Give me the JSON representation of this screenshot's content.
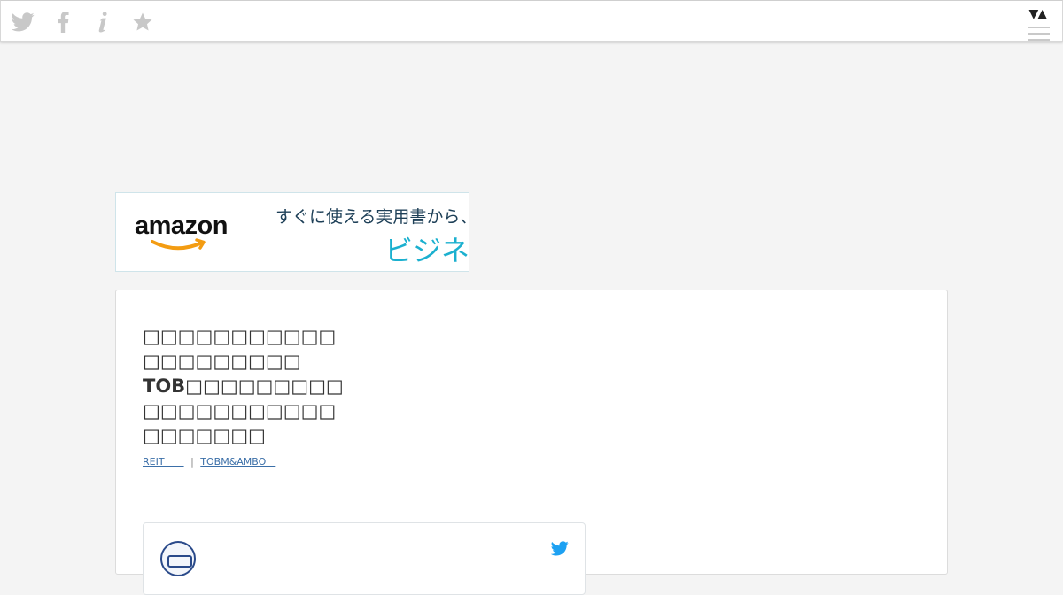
{
  "topbar": {
    "icons": [
      "twitter-icon",
      "facebook-icon",
      "info-icon",
      "star-icon"
    ],
    "sort_label": "▼▲",
    "menu_icon": "hamburger-icon"
  },
  "ad": {
    "brand": "amazon",
    "line1": "すぐに使える実用書から、書",
    "line2": "ビジネス",
    "brand_color": "#111111",
    "accent_color": "#1bb0cf"
  },
  "article": {
    "title_lines": [
      "□□□□□□□□□□□",
      "□□□□□□□□□",
      "TOB□□□□□□□□□",
      "□□□□□□□□□□□",
      "□□□□□□□"
    ],
    "tags": [
      "REIT　　",
      "TOBM&AMBO　"
    ]
  },
  "tweet": {
    "avatar": "avatar",
    "icon": "twitter-bird-icon",
    "icon_color": "#1da1f2"
  }
}
